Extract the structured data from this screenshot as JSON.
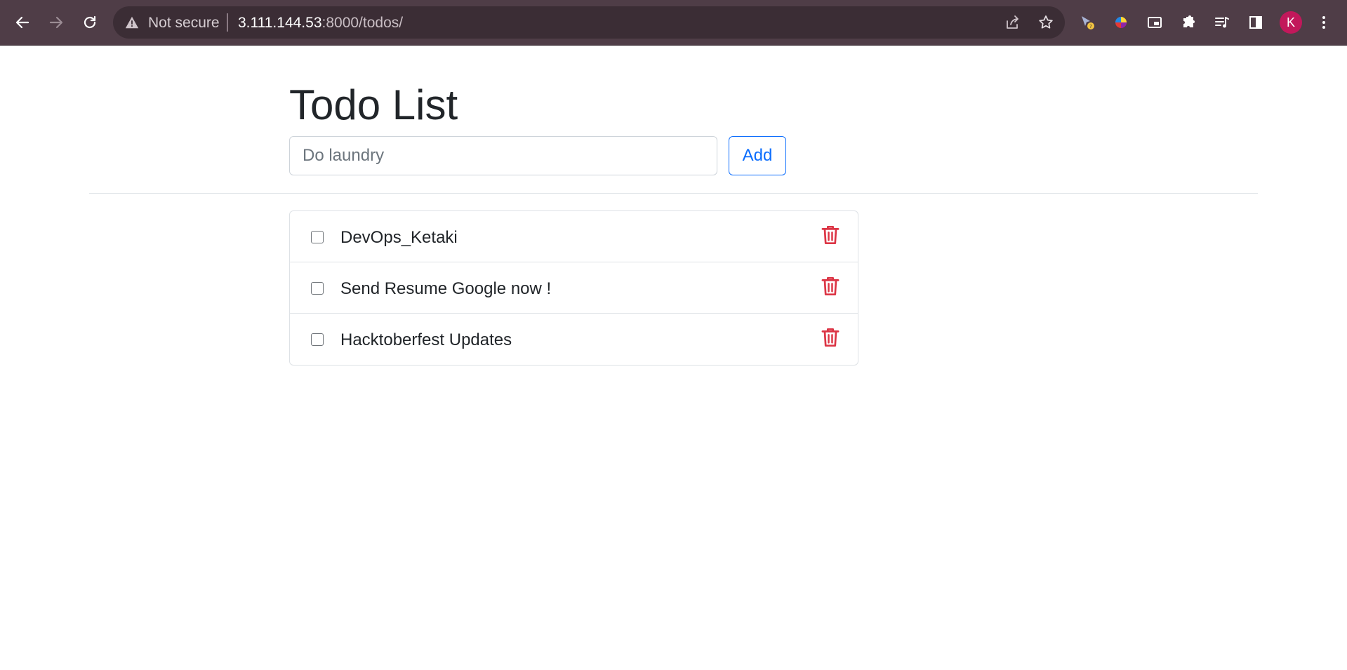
{
  "browser": {
    "security_label": "Not secure",
    "url_host": "3.111.144.53",
    "url_rest": ":8000/todos/",
    "profile_initial": "K",
    "profile_color": "#c2185b"
  },
  "page": {
    "title": "Todo List",
    "input_placeholder": "Do laundry",
    "input_value": "",
    "add_label": "Add",
    "accent_color": "#0d6efd",
    "delete_color": "#dc3545"
  },
  "todos": [
    {
      "text": "DevOps_Ketaki",
      "done": false
    },
    {
      "text": "Send Resume Google now !",
      "done": false
    },
    {
      "text": "Hacktoberfest Updates",
      "done": false
    }
  ]
}
